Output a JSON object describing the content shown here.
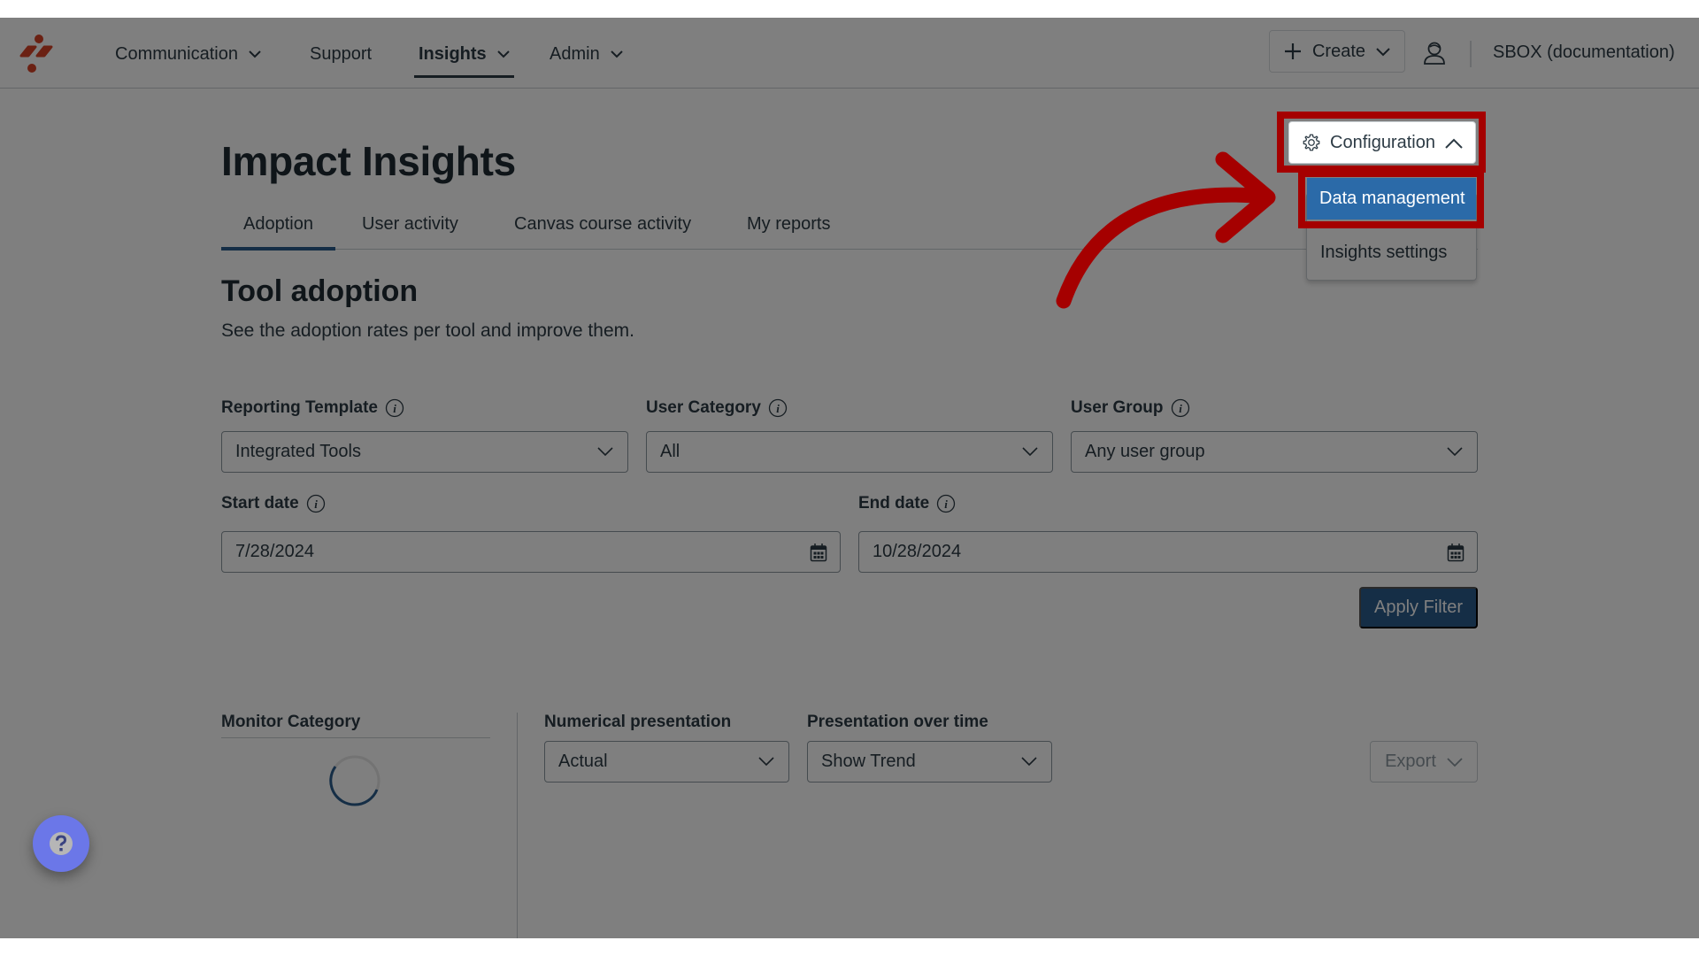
{
  "nav": {
    "items": [
      {
        "label": "Communication",
        "has_dropdown": true
      },
      {
        "label": "Support",
        "has_dropdown": false
      },
      {
        "label": "Insights",
        "has_dropdown": true,
        "active": true
      },
      {
        "label": "Admin",
        "has_dropdown": true
      }
    ],
    "create_label": "Create",
    "account_name": "SBOX (documentation)",
    "icons": {
      "logo": "brand-logo",
      "create": "plus-icon",
      "user": "user-icon"
    }
  },
  "page": {
    "title": "Impact Insights",
    "tabs": [
      {
        "label": "Adoption",
        "active": true
      },
      {
        "label": "User activity"
      },
      {
        "label": "Canvas course activity"
      },
      {
        "label": "My reports"
      }
    ],
    "section_title": "Tool adoption",
    "section_desc": "See the adoption rates per tool and improve them."
  },
  "config": {
    "button_label": "Configuration",
    "menu": [
      {
        "label": "Data management",
        "highlighted": true
      },
      {
        "label": "Insights settings"
      }
    ]
  },
  "filters": {
    "reporting_template": {
      "label": "Reporting Template",
      "value": "Integrated Tools"
    },
    "user_category": {
      "label": "User Category",
      "value": "All"
    },
    "user_group": {
      "label": "User Group",
      "value": "Any user group"
    },
    "start_date": {
      "label": "Start date",
      "value": "7/28/2024"
    },
    "end_date": {
      "label": "End date",
      "value": "10/28/2024"
    },
    "apply_label": "Apply Filter"
  },
  "results": {
    "monitor_category_label": "Monitor Category",
    "numerical_presentation": {
      "label": "Numerical presentation",
      "value": "Actual"
    },
    "presentation_over_time": {
      "label": "Presentation over time",
      "value": "Show Trend"
    },
    "export_label": "Export"
  },
  "colors": {
    "annotation_red": "#a50000",
    "primary_blue": "#2b5d8c",
    "menu_highlight": "#2b6aa8",
    "brand_red": "#d64226",
    "help_fab": "#6b77e8"
  }
}
